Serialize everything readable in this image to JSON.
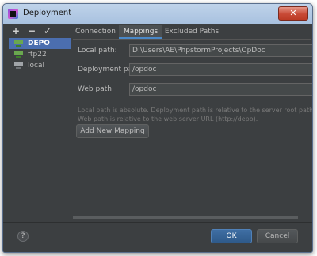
{
  "window": {
    "title": "Deployment",
    "close_glyph": "✕"
  },
  "toolbar": {
    "add_glyph": "+",
    "remove_glyph": "−",
    "apply_glyph": "✓"
  },
  "servers": [
    {
      "label": "DEPO",
      "icon": "server-green-icon",
      "selected": true
    },
    {
      "label": "ftp22",
      "icon": "server-green-icon",
      "selected": false
    },
    {
      "label": "local",
      "icon": "server-local-icon",
      "selected": false
    }
  ],
  "tabs": [
    {
      "label": "Connection",
      "active": false
    },
    {
      "label": "Mappings",
      "active": true
    },
    {
      "label": "Excluded Paths",
      "active": false
    }
  ],
  "mappings": {
    "local_path_label": "Local path:",
    "local_path_value": "D:\\Users\\AE\\PhpstormProjects\\OpDoc",
    "deployment_path_label": "Deployment path:",
    "deployment_path_value": "/opdoc",
    "web_path_label": "Web path:",
    "web_path_value": "/opdoc",
    "hint_line1": "Local path is absolute. Deployment path is relative to the server root path (/var/",
    "hint_line2": "Web path is relative to the web server URL (http://depo).",
    "add_mapping_label": "Add New Mapping"
  },
  "footer": {
    "help_glyph": "?",
    "ok_label": "OK",
    "cancel_label": "Cancel"
  },
  "colors": {
    "accent": "#4b6eaf",
    "background": "#3c3f41",
    "default_button": "#365880"
  }
}
